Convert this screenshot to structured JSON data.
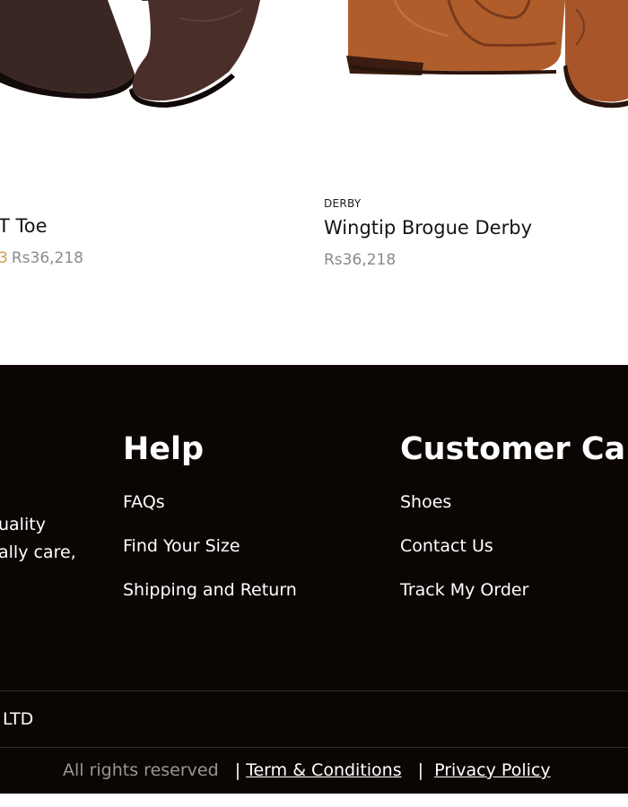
{
  "products": [
    {
      "category": "",
      "name": "T Toe",
      "old_price": "3",
      "price": "Rs36,218"
    },
    {
      "category": "DERBY",
      "name": "Wingtip Brogue Derby",
      "price": "Rs36,218"
    }
  ],
  "footer": {
    "about_lines": [
      "uality",
      "ally care,"
    ],
    "help": {
      "title": "Help",
      "links": [
        "FAQs",
        "Find Your Size",
        "Shipping and Return"
      ]
    },
    "customer_care": {
      "title": "Customer Care",
      "links": [
        "Shoes",
        "Contact Us",
        "Track My Order"
      ]
    },
    "company_text": "LTD",
    "rights_text": "All rights reserved",
    "pipe": "|",
    "terms_label": "Term & Conditions",
    "privacy_label": "Privacy Policy"
  },
  "colors": {
    "footer_bg": "#0b0604",
    "accent_old_price": "#d39a4c",
    "price_grey": "#8a8a8a"
  }
}
